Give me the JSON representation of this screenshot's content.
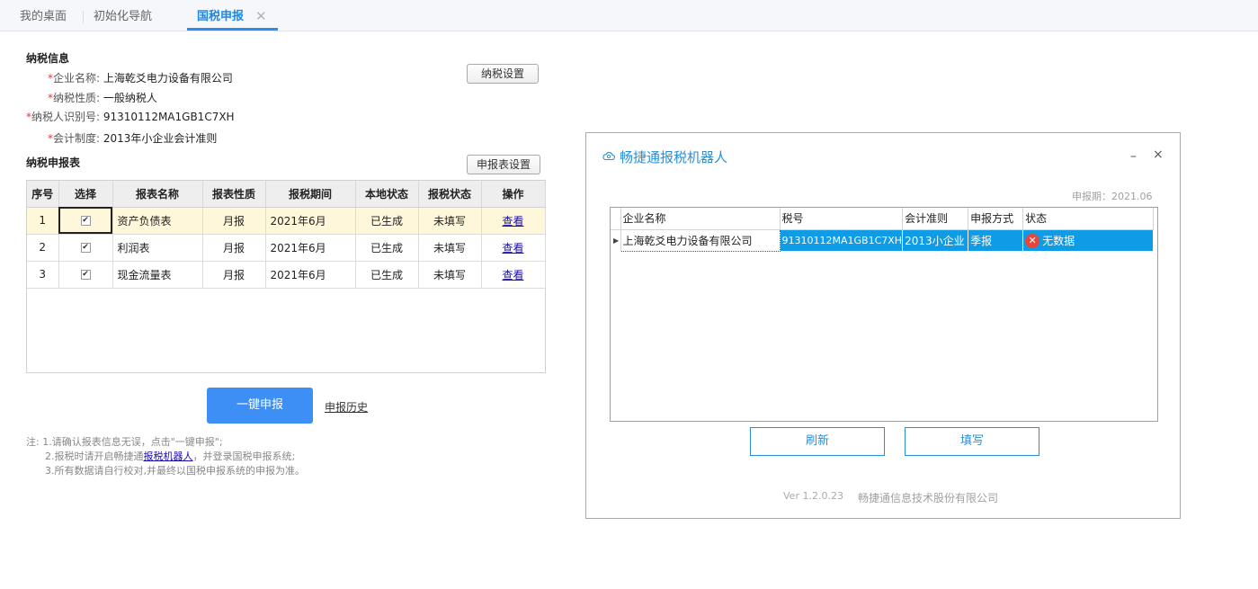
{
  "tabs": {
    "desktop": "我的桌面",
    "init_nav": "初始化导航",
    "tax_report": "国税申报",
    "close_glyph": "✕"
  },
  "tax_info": {
    "section_title": "纳税信息",
    "company_label": "企业名称:",
    "company_value": "上海乾爻电力设备有限公司",
    "nature_label": "纳税性质:",
    "nature_value": "一般纳税人",
    "taxid_label": "纳税人识别号:",
    "taxid_value": "91310112MA1GB1C7XH",
    "accounting_label": "会计制度:",
    "accounting_value": "2013年小企业会计准则",
    "settings_button": "纳税设置",
    "required_mark": "*"
  },
  "report_table": {
    "section_title": "纳税申报表",
    "settings_button": "申报表设置",
    "columns": [
      "序号",
      "选择",
      "报表名称",
      "报表性质",
      "报税期间",
      "本地状态",
      "报税状态",
      "操作"
    ],
    "rows": [
      {
        "no": "1",
        "checked": "✔",
        "name": "资产负债表",
        "nature": "月报",
        "period": "2021年6月",
        "local": "已生成",
        "status": "未填写",
        "action": "查看"
      },
      {
        "no": "2",
        "checked": "✔",
        "name": "利润表",
        "nature": "月报",
        "period": "2021年6月",
        "local": "已生成",
        "status": "未填写",
        "action": "查看"
      },
      {
        "no": "3",
        "checked": "✔",
        "name": "现金流量表",
        "nature": "月报",
        "period": "2021年6月",
        "local": "已生成",
        "status": "未填写",
        "action": "查看"
      }
    ]
  },
  "actions": {
    "submit_all": "一键申报",
    "history": "申报历史"
  },
  "notes": {
    "line1": "注:  1.请确认报表信息无误，点击\"一键申报\";",
    "line2_pre": "2.报税时请开启畅捷通",
    "line2_link": "报税机器人",
    "line2_post": "，并登录国税申报系统;",
    "line3": "3.所有数据请自行校对,并最终以国税申报系统的申报为准。"
  },
  "dialog": {
    "title": "畅捷通报税机器人",
    "minimize": "–",
    "close": "×",
    "period": "申报期：2021.06",
    "columns": [
      "企业名称",
      "税号",
      "会计准则",
      "申报方式",
      "状态"
    ],
    "row": {
      "indicator": "▶",
      "company": "上海乾爻电力设备有限公司",
      "taxid": "91310112MA1GB1C7XH",
      "standard": "2013小企业",
      "method": "季报",
      "status_icon": "✕",
      "status": "无数据"
    },
    "refresh_button": "刷新",
    "fill_button": "填写",
    "version": "Ver 1.2.0.23",
    "company_footer": "畅捷通信息技术股份有限公司"
  },
  "colors": {
    "accent": "#2d8cf0",
    "primary_button": "#3d8ff5",
    "selected_row": "#fff7d9",
    "dialog_accent": "#2a8fd6",
    "grid_selection": "#0f9be6",
    "error": "#e8463a",
    "required": "#e4393c"
  }
}
